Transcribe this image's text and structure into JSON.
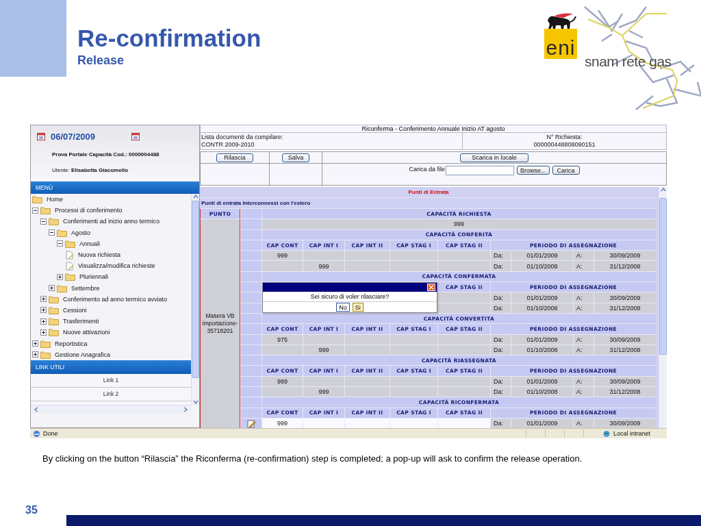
{
  "slide": {
    "title": "Re-confirmation",
    "subtitle": "Release",
    "caption": "By clicking on the button “Rilascia” the Riconferma (re-confirmation) step is completed; a pop-up will ask to confirm the release operation.",
    "page_number": "35"
  },
  "logos": {
    "eni": "eni",
    "snam": "snam rete gas"
  },
  "sidebar": {
    "date": "06/07/2009",
    "portal": "Prova Portale Capacità Cod.: 0000004488",
    "user": "Utente: **Elisabetta Giacomello**",
    "menu_title": "MENÙ",
    "tree": [
      {
        "label": "Home",
        "kind": "folder"
      },
      {
        "label": "Processi di conferimento",
        "kind": "folder",
        "expanded": true,
        "children": [
          {
            "label": "Conferimenti ad inizio anno termico",
            "kind": "folder",
            "expanded": true,
            "children": [
              {
                "label": "Agosto",
                "kind": "folder",
                "expanded": true,
                "children": [
                  {
                    "label": "Annuali",
                    "kind": "folder",
                    "expanded": true,
                    "children": [
                      {
                        "label": "Nuova richiesta",
                        "kind": "document"
                      },
                      {
                        "label": "Visualizza/modifica richieste",
                        "kind": "document"
                      }
                    ]
                  },
                  {
                    "label": "Pluriennali",
                    "kind": "folder",
                    "expanded": false
                  }
                ]
              },
              {
                "label": "Settembre",
                "kind": "folder",
                "expanded": false
              }
            ]
          },
          {
            "label": "Conferimento ad anno termico avviato",
            "kind": "folder",
            "expanded": false
          },
          {
            "label": "Cessioni",
            "kind": "folder",
            "expanded": false
          },
          {
            "label": "Trasferimenti",
            "kind": "folder",
            "expanded": false
          },
          {
            "label": "Nuove attivazioni",
            "kind": "folder",
            "expanded": false
          }
        ]
      },
      {
        "label": "Reportistica",
        "kind": "folder",
        "expanded": false
      },
      {
        "label": "Gestione Anagrafica",
        "kind": "folder",
        "expanded": false
      }
    ],
    "links_title": "LINK UTILI",
    "links": [
      "Link 1",
      "Link 2"
    ]
  },
  "page": {
    "title": "Riconferma - Conferimento Annuale Inizio AT agosto",
    "documents_label": "Lista documenti da compilare:",
    "documents_value": "CONTR 2009-2010",
    "request_label": "N° Richiesta:",
    "request_number": "000000448808090151",
    "buttons": {
      "release": "Rilascia",
      "save": "Salva",
      "download": "Scarica in locale"
    },
    "upload": {
      "label": "Carica da file",
      "browse": "Browse...",
      "load": "Carica"
    }
  },
  "section_title": "Punti di Entrata",
  "group_title": "Punti di entrata Interconnessi con l'estero",
  "table": {
    "point_header": "PUNTO",
    "point_name": "Masera VB importazione-35718201",
    "blocks": [
      {
        "kind": "total",
        "title": "CAPACITÀ RICHIESTA",
        "value": "999"
      },
      {
        "kind": "periods",
        "title": "CAPACITÀ CONFERITA",
        "headers": {
          "cap_cont": "CAP CONT",
          "cap_int_i": "CAP INT I",
          "cap_int_ii": "CAP INT II",
          "cap_stag_i": "CAP STAG I",
          "cap_stag_ii": "CAP STAG II",
          "period": "PERIODO DI ASSEGNAZIONE"
        },
        "rows": [
          {
            "editable": false,
            "cap_cont": "999",
            "from_label": "Da:",
            "from": "01/01/2009",
            "to_label": "A:",
            "to": "30/09/2009"
          },
          {
            "editable": false,
            "cap_int_i": "999",
            "from_label": "Da:",
            "from": "01/10/2008",
            "to_label": "A:",
            "to": "31/12/2008"
          }
        ]
      },
      {
        "kind": "periods",
        "title": "CAPACITÀ CONFERMATA",
        "headers": {
          "cap_stag_ii": "CAP STAG II",
          "period": "PERIODO DI ASSEGNAZIONE"
        },
        "rows": [
          {
            "editable": false,
            "from_label": "Da:",
            "from": "01/01/2009",
            "to_label": "A:",
            "to": "30/09/2009"
          },
          {
            "editable": false,
            "from_label": "Da:",
            "from": "01/10/2008",
            "to_label": "A:",
            "to": "31/12/2008"
          }
        ]
      },
      {
        "kind": "periods",
        "title": "CAPACITÀ CONVERTITA",
        "headers": {
          "cap_cont": "CAP CONT",
          "cap_int_i": "CAP INT I",
          "cap_int_ii": "CAP INT II",
          "cap_stag_i": "CAP STAG I",
          "cap_stag_ii": "CAP STAG II",
          "period": "PERIODO DI ASSEGNAZIONE"
        },
        "rows": [
          {
            "editable": false,
            "cap_cont": "975",
            "from_label": "Da:",
            "from": "01/01/2009",
            "to_label": "A:",
            "to": "30/09/2009"
          },
          {
            "editable": false,
            "cap_int_i": "999",
            "from_label": "Da:",
            "from": "01/10/2008",
            "to_label": "A:",
            "to": "31/12/2008"
          }
        ]
      },
      {
        "kind": "periods",
        "title": "CAPACITÀ RIASSEGNATA",
        "headers": {
          "cap_cont": "CAP CONT",
          "cap_int_i": "CAP INT I",
          "cap_int_ii": "CAP INT II",
          "cap_stag_i": "CAP STAG I",
          "cap_stag_ii": "CAP STAG II",
          "period": "PERIODO DI ASSEGNAZIONE"
        },
        "rows": [
          {
            "editable": false,
            "cap_cont": "999",
            "from_label": "Da:",
            "from": "01/01/2009",
            "to_label": "A:",
            "to": "30/09/2009"
          },
          {
            "editable": false,
            "cap_int_i": "999",
            "from_label": "Da:",
            "from": "01/10/2008",
            "to_label": "A:",
            "to": "31/12/2008"
          }
        ]
      },
      {
        "kind": "periods",
        "title": "CAPACITÀ RICONFERMATA",
        "headers": {
          "cap_cont": "CAP CONT",
          "cap_int_i": "CAP INT I",
          "cap_int_ii": "CAP INT II",
          "cap_stag_i": "CAP STAG I",
          "cap_stag_ii": "CAP STAG II",
          "period": "PERIODO DI ASSEGNAZIONE"
        },
        "rows": [
          {
            "editable": true,
            "cap_cont": "999",
            "from_label": "Da:",
            "from": "01/01/2009",
            "to_label": "A:",
            "to": "30/09/2009"
          }
        ]
      }
    ]
  },
  "dialog": {
    "message": "Sei sicuro di voler rilasciare?",
    "buttons": [
      "No",
      "Si"
    ]
  },
  "status_bar": {
    "status": "Done",
    "zone": "Local intranet"
  }
}
